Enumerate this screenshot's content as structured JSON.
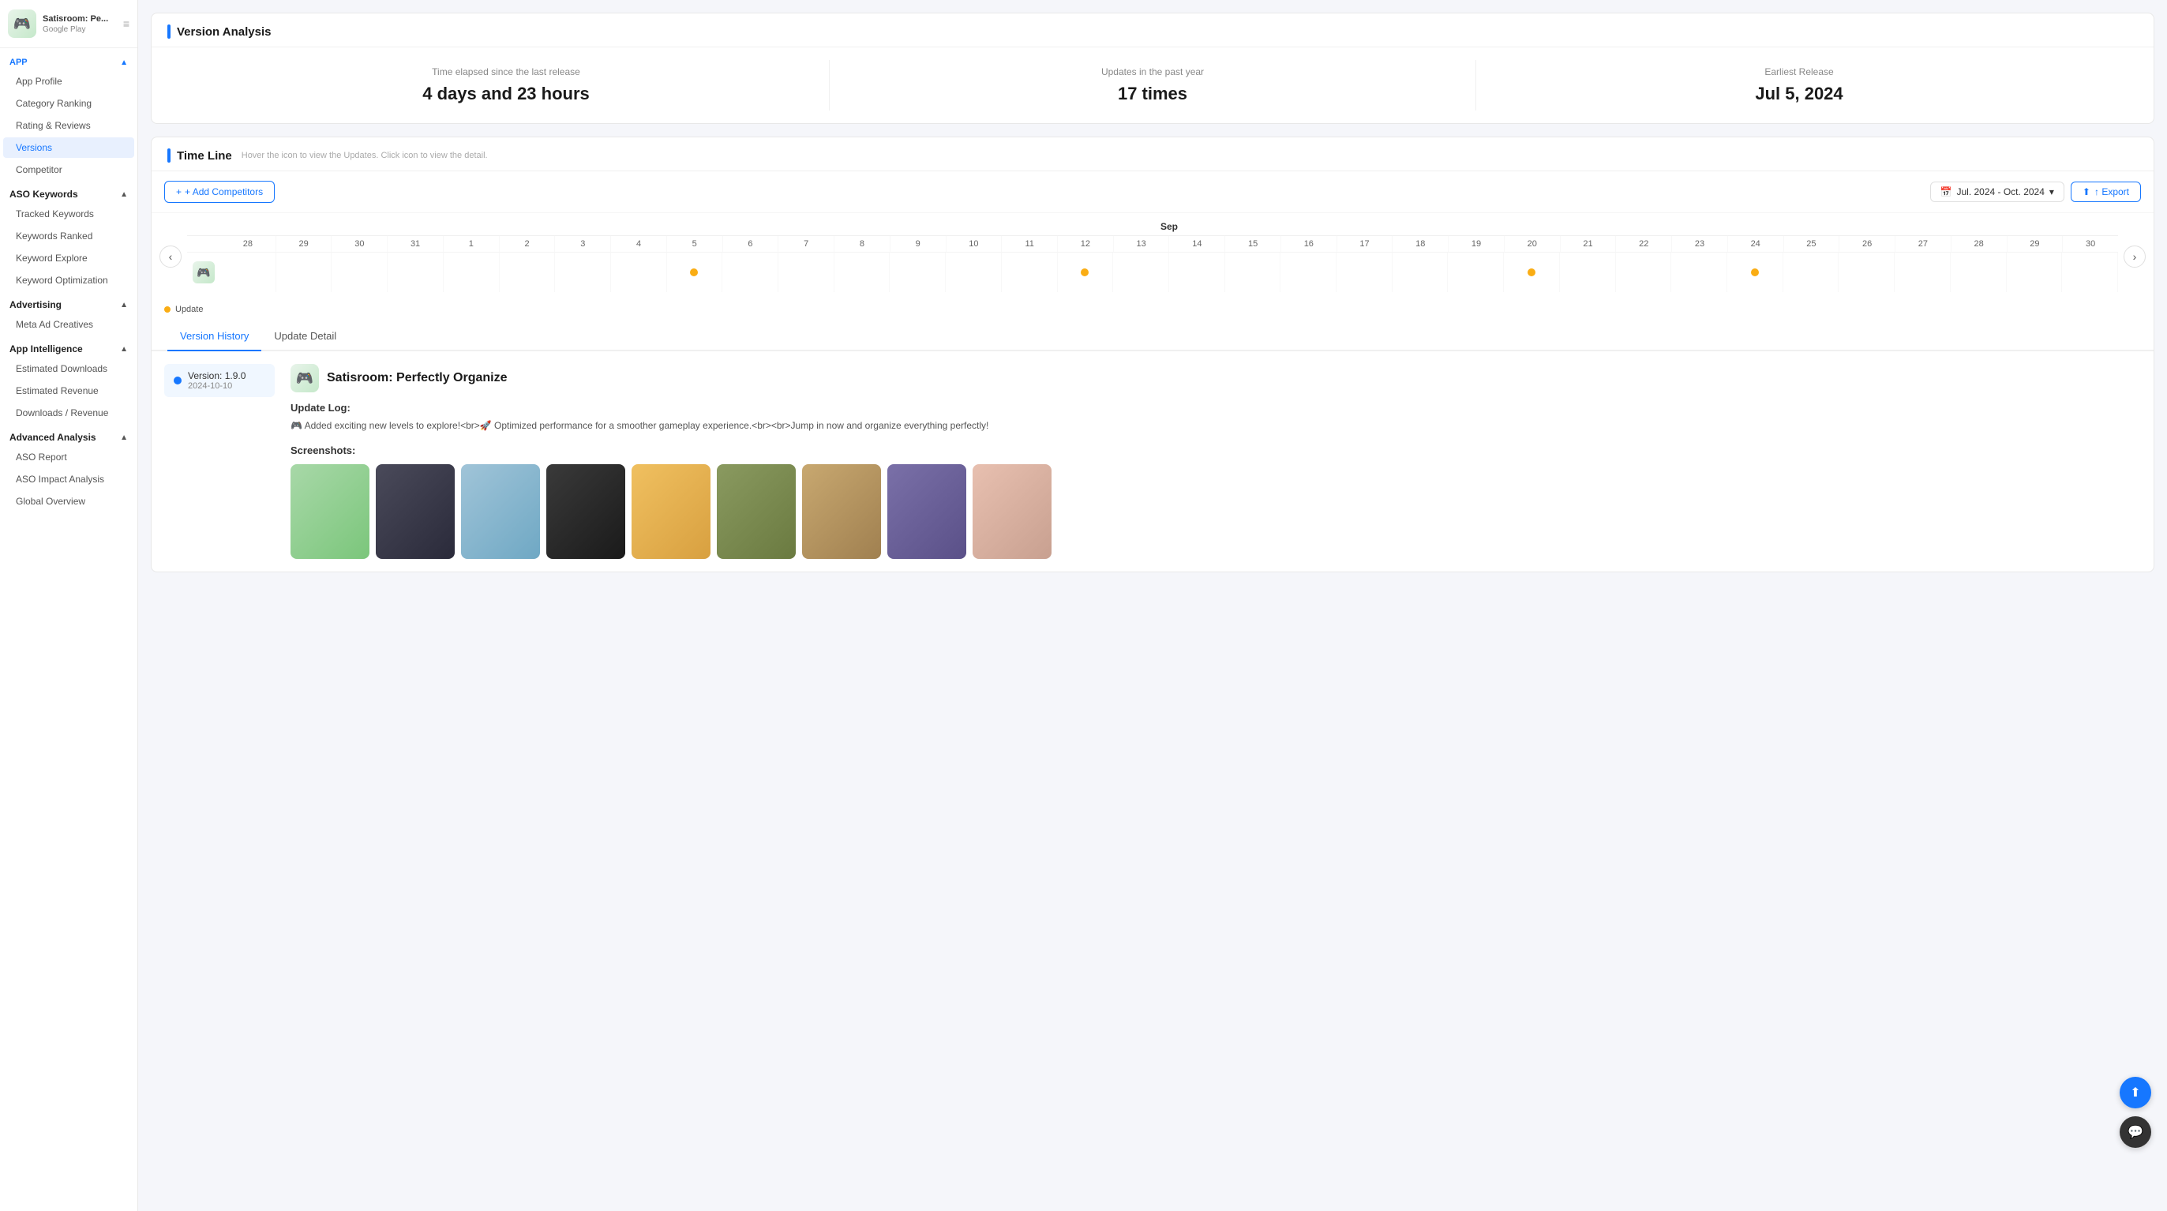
{
  "sidebar": {
    "app_name": "Satisroom: Pe...",
    "app_store": "Google Play",
    "app_emoji": "🎮",
    "sections": {
      "app": {
        "label": "APP",
        "items": [
          {
            "id": "app-profile",
            "label": "App Profile",
            "active": false
          },
          {
            "id": "category-ranking",
            "label": "Category Ranking",
            "active": false
          },
          {
            "id": "rating-reviews",
            "label": "Rating & Reviews",
            "active": false
          },
          {
            "id": "versions",
            "label": "Versions",
            "active": true
          },
          {
            "id": "competitor",
            "label": "Competitor",
            "active": false
          }
        ]
      },
      "aso_keywords": {
        "label": "ASO Keywords",
        "items": [
          {
            "id": "tracked-keywords",
            "label": "Tracked Keywords",
            "active": false
          },
          {
            "id": "keywords-ranked",
            "label": "Keywords Ranked",
            "active": false
          },
          {
            "id": "keyword-explore",
            "label": "Keyword Explore",
            "active": false
          },
          {
            "id": "keyword-optimization",
            "label": "Keyword Optimization",
            "active": false
          }
        ]
      },
      "advertising": {
        "label": "Advertising",
        "items": [
          {
            "id": "meta-ad-creatives",
            "label": "Meta Ad Creatives",
            "active": false
          }
        ]
      },
      "app_intelligence": {
        "label": "App Intelligence",
        "items": [
          {
            "id": "estimated-downloads",
            "label": "Estimated Downloads",
            "active": false
          },
          {
            "id": "estimated-revenue",
            "label": "Estimated Revenue",
            "active": false
          },
          {
            "id": "downloads-revenue",
            "label": "Downloads / Revenue",
            "active": false
          }
        ]
      },
      "advanced_analysis": {
        "label": "Advanced Analysis",
        "items": [
          {
            "id": "aso-report",
            "label": "ASO Report",
            "active": false
          },
          {
            "id": "aso-impact-analysis",
            "label": "ASO Impact Analysis",
            "active": false
          },
          {
            "id": "global-overview",
            "label": "Global Overview",
            "active": false
          }
        ]
      }
    }
  },
  "version_analysis": {
    "title": "Version Analysis",
    "stats": [
      {
        "label": "Time elapsed since the last release",
        "value": "4 days and 23 hours"
      },
      {
        "label": "Updates in the past year",
        "value": "17 times"
      },
      {
        "label": "Earliest Release",
        "value": "Jul 5, 2024"
      }
    ]
  },
  "timeline": {
    "title": "Time Line",
    "hint": "Hover the icon to view the Updates. Click icon to view the detail.",
    "add_competitors_label": "+ Add Competitors",
    "date_range": "Jul. 2024  -  Oct. 2024",
    "export_label": "↑ Export",
    "legend_label": "Update",
    "month_label": "Sep",
    "dates": [
      28,
      29,
      30,
      31,
      1,
      2,
      3,
      4,
      5,
      6,
      7,
      8,
      9,
      10,
      11,
      12,
      13,
      14,
      15,
      16,
      17,
      18,
      19,
      20,
      21,
      22,
      23,
      24,
      25,
      26,
      27,
      28,
      29,
      30
    ],
    "events": [
      5,
      12,
      20,
      24
    ]
  },
  "version_history": {
    "tabs": [
      {
        "id": "version-history",
        "label": "Version History",
        "active": true
      },
      {
        "id": "update-detail",
        "label": "Update Detail",
        "active": false
      }
    ],
    "selected_version": {
      "version": "Version: 1.9.0",
      "date": "2024-10-10",
      "app_name": "Satisroom: Perfectly Organize",
      "update_log_label": "Update Log:",
      "update_log": "🎮 Added exciting new levels to explore!<br>🚀 Optimized performance for a smoother gameplay experience.<br><br>Jump in now and organize everything perfectly!",
      "screenshots_label": "Screenshots:"
    }
  },
  "screenshots": [
    {
      "id": "ss1",
      "color_class": "ss-green"
    },
    {
      "id": "ss2",
      "color_class": "ss-dark"
    },
    {
      "id": "ss3",
      "color_class": "ss-blue"
    },
    {
      "id": "ss4",
      "color_class": "ss-black"
    },
    {
      "id": "ss5",
      "color_class": "ss-yellow"
    },
    {
      "id": "ss6",
      "color_class": "ss-olive"
    },
    {
      "id": "ss7",
      "color_class": "ss-brown"
    },
    {
      "id": "ss8",
      "color_class": "ss-purple"
    },
    {
      "id": "ss9",
      "color_class": "ss-pink"
    }
  ]
}
